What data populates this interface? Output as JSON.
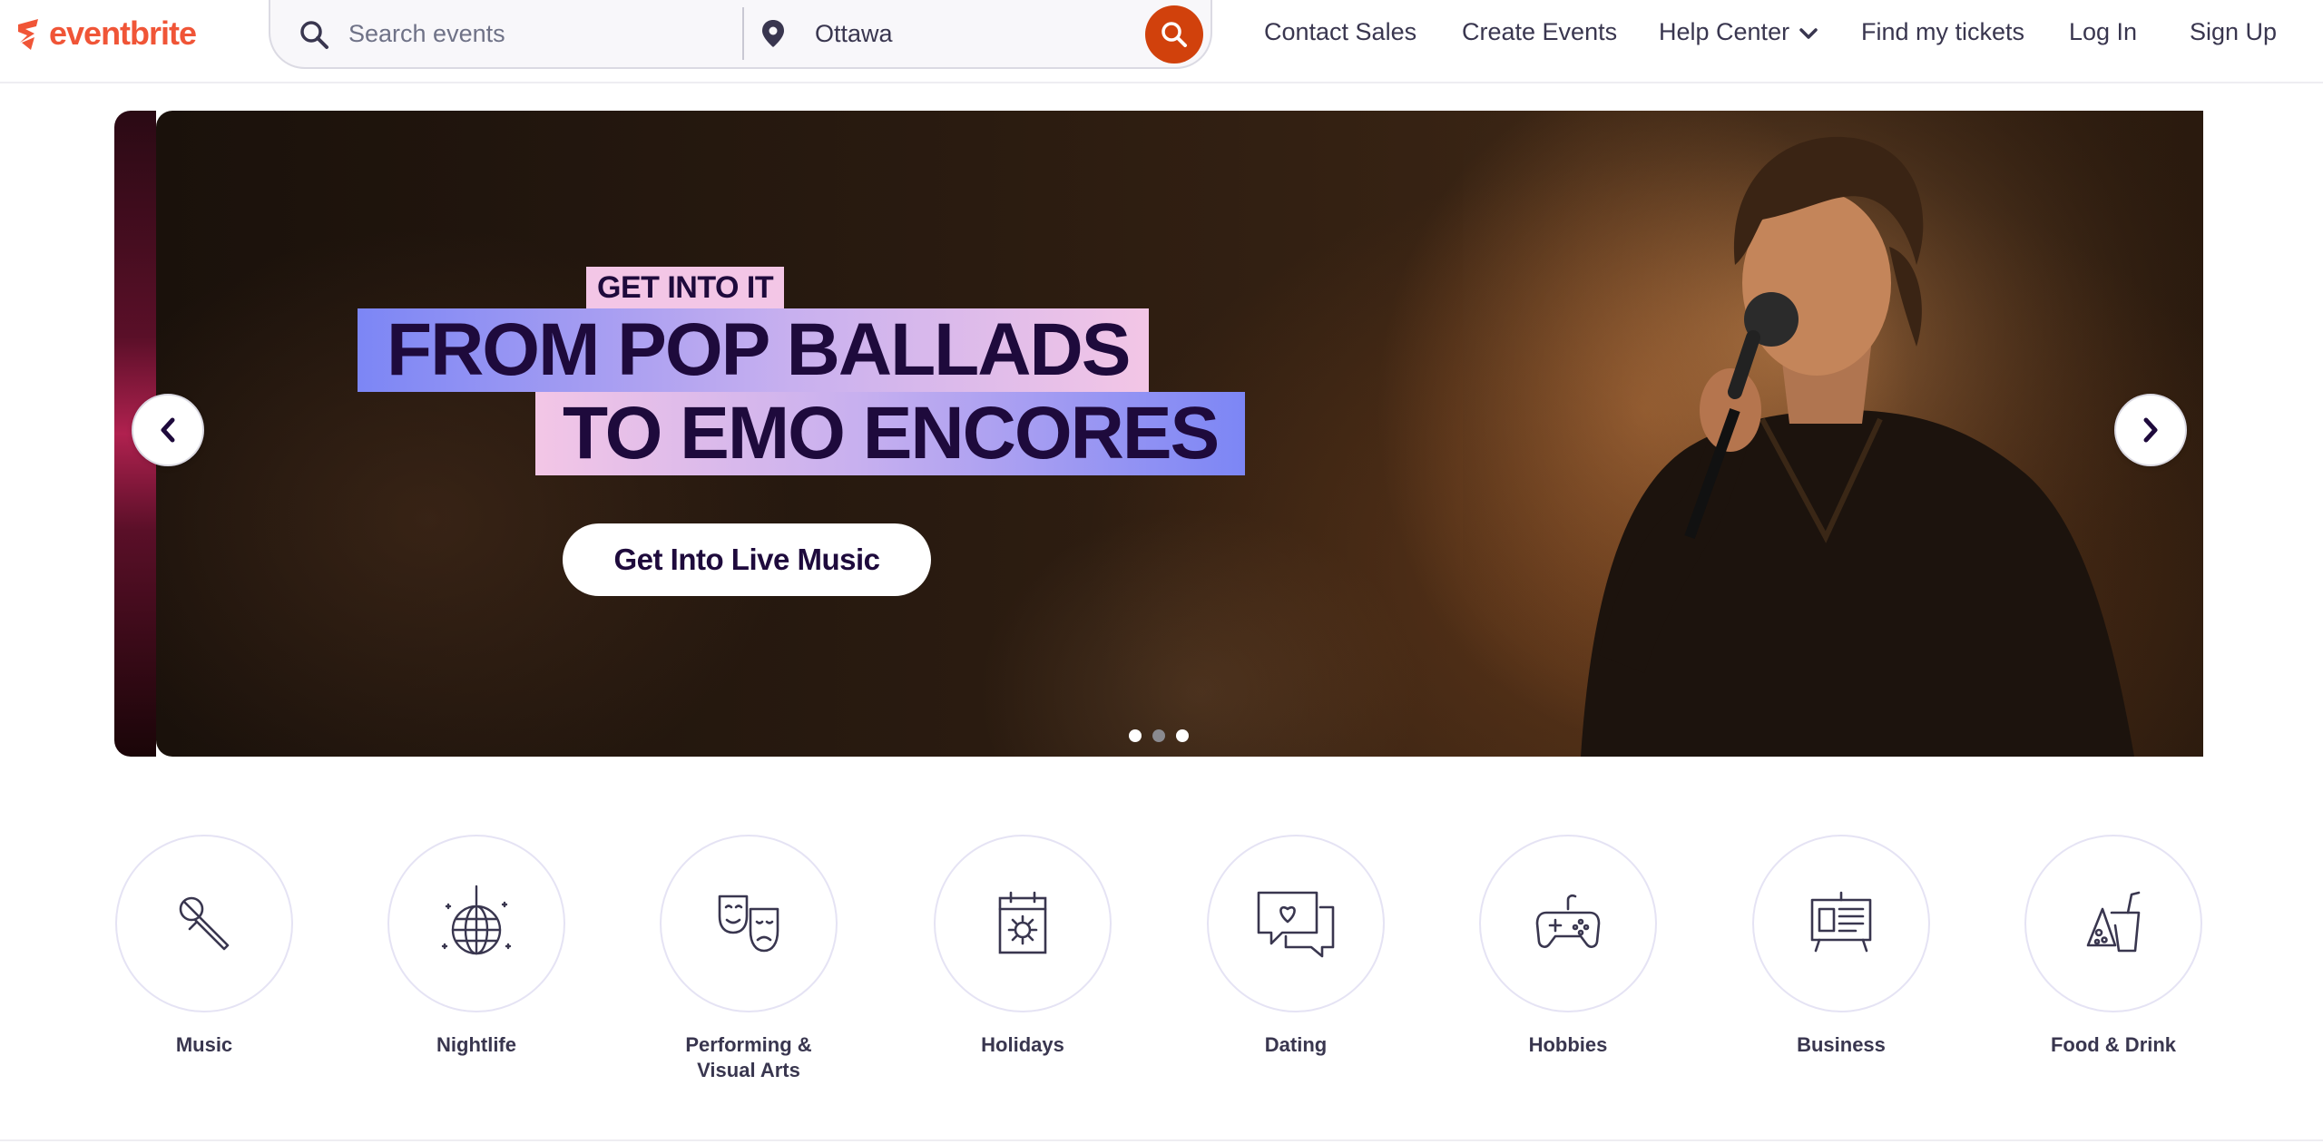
{
  "header": {
    "logo_text": "eventbrite",
    "search": {
      "placeholder": "Search events",
      "value": ""
    },
    "location": {
      "value": "Ottawa"
    },
    "nav": [
      {
        "label": "Contact Sales"
      },
      {
        "label": "Create Events"
      },
      {
        "label": "Help Center"
      },
      {
        "label": "Find my tickets"
      },
      {
        "label": "Log In"
      },
      {
        "label": "Sign Up"
      }
    ]
  },
  "hero": {
    "eyebrow": "GET INTO IT",
    "headline_line1": "FROM POP BALLADS",
    "headline_line2": "TO EMO ENCORES",
    "cta_label": "Get Into Live Music",
    "active_slide": 2,
    "slide_count": 3
  },
  "categories": [
    {
      "label": "Music",
      "icon": "microphone-icon"
    },
    {
      "label": "Nightlife",
      "icon": "disco-ball-icon"
    },
    {
      "label": "Performing & Visual Arts",
      "icon": "theater-masks-icon"
    },
    {
      "label": "Holidays",
      "icon": "calendar-sun-icon"
    },
    {
      "label": "Dating",
      "icon": "chat-heart-icon"
    },
    {
      "label": "Hobbies",
      "icon": "gamepad-icon"
    },
    {
      "label": "Business",
      "icon": "presentation-board-icon"
    },
    {
      "label": "Food & Drink",
      "icon": "food-drink-icon"
    }
  ],
  "colors": {
    "brand": "#f05537",
    "search_button": "#d1410c",
    "text_primary": "#1e0a3c",
    "text_secondary": "#39364f"
  }
}
